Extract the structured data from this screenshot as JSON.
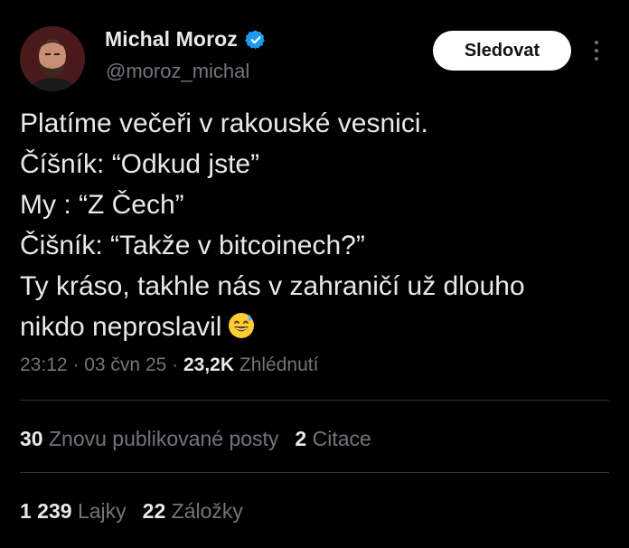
{
  "author": {
    "display_name": "Michal Moroz",
    "handle": "@moroz_michal",
    "verified": true
  },
  "actions": {
    "follow_label": "Sledovat"
  },
  "tweet": {
    "lines": [
      "Platíme večeři v rakouské vesnici.",
      "Číšník: “Odkud jste”",
      "My : “Z Čech”",
      "Čišník: “Takže v bitcoinech?”",
      "Ty kráso, takhle nás v zahraničí už dlouho",
      "nikdo neproslavil"
    ],
    "emoji": "grinning-face-with-sweat"
  },
  "meta": {
    "time": "23:12",
    "sep1": " · ",
    "date": "03 čvn 25",
    "sep2": " · ",
    "views_count": "23,2K",
    "views_label": "Zhlédnutí"
  },
  "stats": {
    "reposts_count": "30",
    "reposts_label": "Znovu publikované posty",
    "quotes_count": "2",
    "quotes_label": "Citace",
    "likes_count": "1 239",
    "likes_label": "Lajky",
    "bookmarks_count": "22",
    "bookmarks_label": "Záložky"
  },
  "colors": {
    "background": "#000000",
    "text_primary": "#e7e9ea",
    "text_secondary": "#71767b",
    "verified_blue": "#1d9bf0",
    "divider": "#2f3336",
    "follow_bg": "#ffffff"
  }
}
